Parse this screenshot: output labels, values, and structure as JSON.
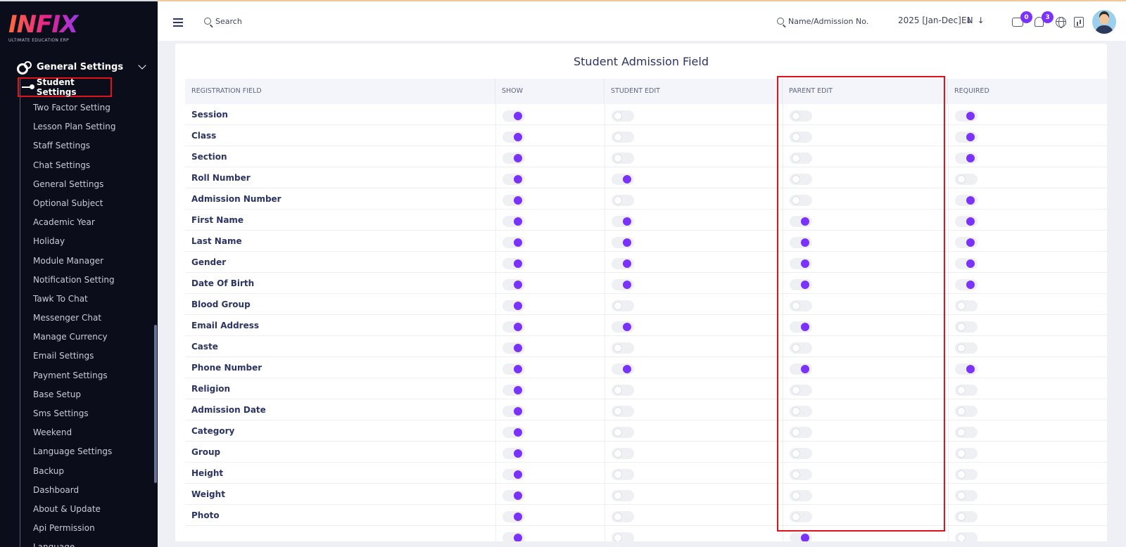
{
  "sidebar": {
    "logo": "INFIX",
    "logo_tagline": "ULTIMATE EDUCATION ERP",
    "section_label": "General Settings",
    "active_item": "Student Settings",
    "items": [
      "Two Factor Setting",
      "Lesson Plan Setting",
      "Staff Settings",
      "Chat Settings",
      "General Settings",
      "Optional Subject",
      "Academic Year",
      "Holiday",
      "Module Manager",
      "Notification Setting",
      "Tawk To Chat",
      "Messenger Chat",
      "Manage Currency",
      "Email Settings",
      "Payment Settings",
      "Base Setup",
      "Sms Settings",
      "Weekend",
      "Language Settings",
      "Backup",
      "Dashboard",
      "About & Update",
      "Api Permission",
      "Language"
    ]
  },
  "topbar": {
    "search_label": "Search",
    "name_search_label": "Name/Admission No.",
    "year": "2025 [Jan-Dec]",
    "lang": "EN",
    "chat_count": "0",
    "notification_count": "3"
  },
  "card": {
    "title": "Student Admission Field",
    "columns": [
      "REGISTRATION FIELD",
      "SHOW",
      "STUDENT EDIT",
      "PARENT EDIT",
      "REQUIRED"
    ],
    "rows": [
      {
        "label": "Session",
        "show": true,
        "student_edit": false,
        "parent_edit": false,
        "required": true
      },
      {
        "label": "Class",
        "show": true,
        "student_edit": false,
        "parent_edit": false,
        "required": true
      },
      {
        "label": "Section",
        "show": true,
        "student_edit": false,
        "parent_edit": false,
        "required": true
      },
      {
        "label": "Roll Number",
        "show": true,
        "student_edit": true,
        "parent_edit": false,
        "required": false
      },
      {
        "label": "Admission Number",
        "show": true,
        "student_edit": false,
        "parent_edit": false,
        "required": true
      },
      {
        "label": "First Name",
        "show": true,
        "student_edit": true,
        "parent_edit": true,
        "required": true
      },
      {
        "label": "Last Name",
        "show": true,
        "student_edit": true,
        "parent_edit": true,
        "required": true
      },
      {
        "label": "Gender",
        "show": true,
        "student_edit": true,
        "parent_edit": true,
        "required": true
      },
      {
        "label": "Date Of Birth",
        "show": true,
        "student_edit": true,
        "parent_edit": true,
        "required": true
      },
      {
        "label": "Blood Group",
        "show": true,
        "student_edit": false,
        "parent_edit": false,
        "required": false
      },
      {
        "label": "Email Address",
        "show": true,
        "student_edit": true,
        "parent_edit": true,
        "required": false
      },
      {
        "label": "Caste",
        "show": true,
        "student_edit": false,
        "parent_edit": false,
        "required": false
      },
      {
        "label": "Phone Number",
        "show": true,
        "student_edit": true,
        "parent_edit": true,
        "required": true
      },
      {
        "label": "Religion",
        "show": true,
        "student_edit": false,
        "parent_edit": false,
        "required": false
      },
      {
        "label": "Admission Date",
        "show": true,
        "student_edit": false,
        "parent_edit": false,
        "required": false
      },
      {
        "label": "Category",
        "show": true,
        "student_edit": false,
        "parent_edit": false,
        "required": false
      },
      {
        "label": "Group",
        "show": true,
        "student_edit": false,
        "parent_edit": false,
        "required": false
      },
      {
        "label": "Height",
        "show": true,
        "student_edit": false,
        "parent_edit": false,
        "required": false
      },
      {
        "label": "Weight",
        "show": true,
        "student_edit": false,
        "parent_edit": false,
        "required": false
      },
      {
        "label": "Photo",
        "show": true,
        "student_edit": false,
        "parent_edit": false,
        "required": false
      },
      {
        "label": "",
        "show": true,
        "student_edit": false,
        "parent_edit": true,
        "required": false
      }
    ]
  }
}
